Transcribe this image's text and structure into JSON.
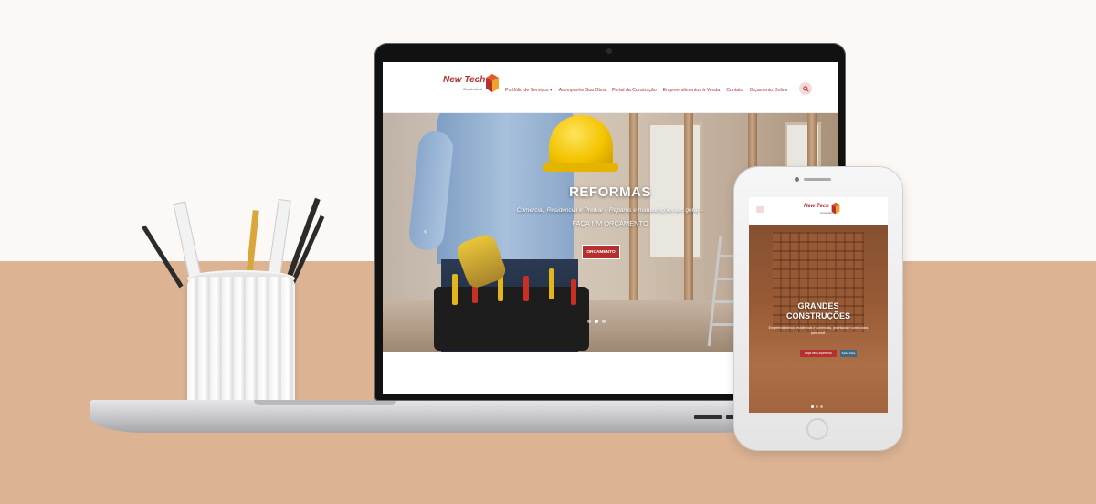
{
  "colors": {
    "brand": "#b5302f",
    "desk": "#dcb393",
    "wall": "#fbf8f6"
  },
  "laptop_site": {
    "logo": {
      "name": "New Tech",
      "tagline": "Construtora"
    },
    "menu": [
      "Portfólio de Serviços ▾",
      "Acompanhe Sua Obra",
      "Portal da Construção",
      "Empreendimentos à Venda",
      "Contato",
      "Orçamento Online"
    ],
    "search_icon": "search-icon",
    "hero": {
      "title": "REFORMAS",
      "subtitle": "Comercial, Residencial e Predial – Reparos e manutenções em geral –",
      "subtitle2": "FAÇA UM ORÇAMENTO",
      "button": "ORÇAMENTO",
      "prev_icon": "‹"
    }
  },
  "phone_site": {
    "logo": {
      "name": "New Tech",
      "tagline": "Construtora"
    },
    "menu_icon": "menu-icon",
    "hero": {
      "title_line1": "GRANDES",
      "title_line2": "CONSTRUÇÕES",
      "subtitle": "Empreendimentos residenciais e comerciais, projetados e construídos para você.",
      "button_primary": "Faça seu Orçamento",
      "button_secondary": "Saiba Mais"
    }
  }
}
